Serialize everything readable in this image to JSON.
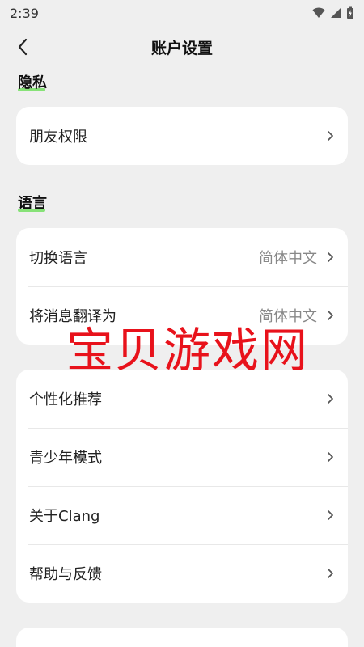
{
  "status": {
    "time": "2:39"
  },
  "header": {
    "title": "账户设置"
  },
  "sections": [
    {
      "label": "隐私",
      "items": [
        {
          "label": "朋友权限"
        }
      ]
    },
    {
      "label": "语言",
      "items": [
        {
          "label": "切换语言",
          "value": "简体中文"
        },
        {
          "label": "将消息翻译为",
          "value": "简体中文"
        }
      ]
    }
  ],
  "general_items": [
    {
      "label": "个性化推荐"
    },
    {
      "label": "青少年模式"
    },
    {
      "label": "关于Clang"
    },
    {
      "label": "帮助与反馈"
    }
  ],
  "watermark": "宝贝游戏网",
  "colors": {
    "accent_underline": "#7be06a",
    "watermark": "#e8121b",
    "background": "#efefef"
  }
}
